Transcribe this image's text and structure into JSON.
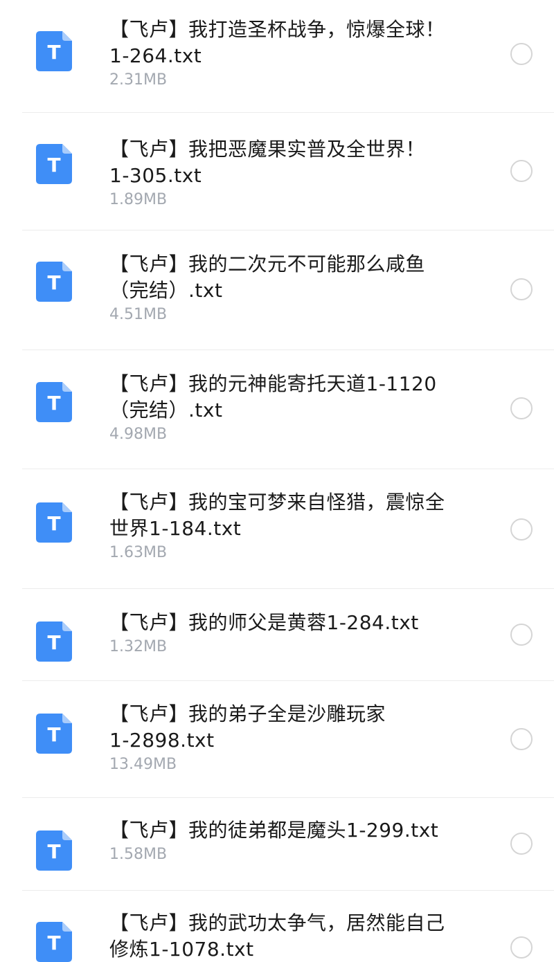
{
  "colors": {
    "icon_blue": "#3f8ef7",
    "icon_fold": "#a9ccfb",
    "name_text": "#1a1a1a",
    "size_text": "#a3a8b0",
    "divider": "#ececec",
    "radio_border": "#d5d5d5"
  },
  "files": [
    {
      "name_line1": "【飞卢】我打造圣杯战争，惊爆全球！",
      "name_line2": "1-264.txt",
      "size": "2.31MB",
      "icon": "txt-file-icon",
      "icon_letter": "T",
      "selected": false
    },
    {
      "name_line1": "【飞卢】我把恶魔果实普及全世界！",
      "name_line2": "1-305.txt",
      "size": "1.89MB",
      "icon": "txt-file-icon",
      "icon_letter": "T",
      "selected": false
    },
    {
      "name_line1": "【飞卢】我的二次元不可能那么咸鱼",
      "name_line2": "（完结）.txt",
      "size": "4.51MB",
      "icon": "txt-file-icon",
      "icon_letter": "T",
      "selected": false
    },
    {
      "name_line1": "【飞卢】我的元神能寄托天道1-1120",
      "name_line2": "（完结）.txt",
      "size": "4.98MB",
      "icon": "txt-file-icon",
      "icon_letter": "T",
      "selected": false
    },
    {
      "name_line1": "【飞卢】我的宝可梦来自怪猎，震惊全",
      "name_line2": "世界1-184.txt",
      "size": "1.63MB",
      "icon": "txt-file-icon",
      "icon_letter": "T",
      "selected": false
    },
    {
      "name_line1": "【飞卢】我的师父是黄蓉1-284.txt",
      "name_line2": "",
      "size": "1.32MB",
      "icon": "txt-file-icon",
      "icon_letter": "T",
      "selected": false
    },
    {
      "name_line1": "【飞卢】我的弟子全是沙雕玩家",
      "name_line2": "1-2898.txt",
      "size": "13.49MB",
      "icon": "txt-file-icon",
      "icon_letter": "T",
      "selected": false
    },
    {
      "name_line1": "【飞卢】我的徒弟都是魔头1-299.txt",
      "name_line2": "",
      "size": "1.58MB",
      "icon": "txt-file-icon",
      "icon_letter": "T",
      "selected": false
    },
    {
      "name_line1": "【飞卢】我的武功太争气，居然能自己",
      "name_line2": "修炼1-1078.txt",
      "size": "",
      "icon": "txt-file-icon",
      "icon_letter": "T",
      "selected": false
    }
  ]
}
